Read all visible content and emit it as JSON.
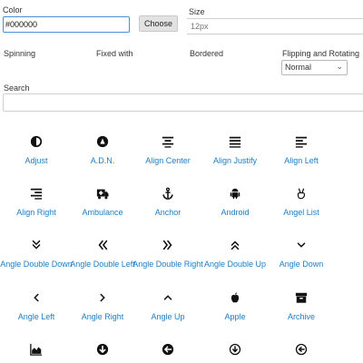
{
  "controls": {
    "color_label": "Color",
    "color_value": "#000000",
    "choose_label": "Choose",
    "size_label": "Size",
    "size_placeholder": "12px",
    "spinning_label": "Spinning",
    "fixed_width_label": "Fixed with",
    "bordered_label": "Bordered",
    "flip_label": "Flipping and Rotating",
    "flip_value": "Normal",
    "search_label": "Search"
  },
  "accent_color": "#1b7dc4",
  "icons": [
    {
      "label": "Adjust",
      "icon": "adjust-icon"
    },
    {
      "label": "A.D.N.",
      "icon": "adn-icon"
    },
    {
      "label": "Align Center",
      "icon": "align-center-icon"
    },
    {
      "label": "Align Justify",
      "icon": "align-justify-icon"
    },
    {
      "label": "Align Left",
      "icon": "align-left-icon"
    },
    {
      "label": "Align Right",
      "icon": "align-right-icon"
    },
    {
      "label": "Ambulance",
      "icon": "ambulance-icon"
    },
    {
      "label": "Anchor",
      "icon": "anchor-icon"
    },
    {
      "label": "Android",
      "icon": "android-icon"
    },
    {
      "label": "Angel List",
      "icon": "angellist-icon"
    },
    {
      "label": "Angle Double Down",
      "icon": "angle-double-down-icon"
    },
    {
      "label": "Angle Double Left",
      "icon": "angle-double-left-icon"
    },
    {
      "label": "Angle Double Right",
      "icon": "angle-double-right-icon"
    },
    {
      "label": "Angle Double Up",
      "icon": "angle-double-up-icon"
    },
    {
      "label": "Angle Down",
      "icon": "angle-down-icon"
    },
    {
      "label": "Angle Left",
      "icon": "angle-left-icon"
    },
    {
      "label": "Angle Right",
      "icon": "angle-right-icon"
    },
    {
      "label": "Angle Up",
      "icon": "angle-up-icon"
    },
    {
      "label": "Apple",
      "icon": "apple-icon"
    },
    {
      "label": "Archive",
      "icon": "archive-icon"
    },
    {
      "label": "",
      "icon": "area-chart-icon"
    },
    {
      "label": "",
      "icon": "arrow-circle-down-icon"
    },
    {
      "label": "",
      "icon": "arrow-circle-left-icon"
    },
    {
      "label": "",
      "icon": "arrow-circle-o-down-icon"
    },
    {
      "label": "",
      "icon": "arrow-circle-o-left-icon"
    }
  ]
}
